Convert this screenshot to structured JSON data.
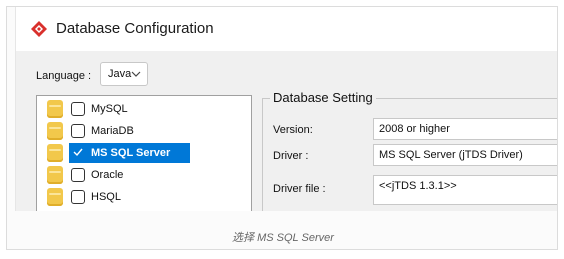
{
  "window": {
    "title": "Database Configuration",
    "icon": "app-logo-icon"
  },
  "language": {
    "label": "Language :",
    "value": "Java"
  },
  "databases": [
    {
      "label": "MySQL",
      "checked": false,
      "selected": false
    },
    {
      "label": "MariaDB",
      "checked": false,
      "selected": false
    },
    {
      "label": "MS SQL Server",
      "checked": true,
      "selected": true
    },
    {
      "label": "Oracle",
      "checked": false,
      "selected": false
    },
    {
      "label": "HSQL",
      "checked": false,
      "selected": false
    }
  ],
  "database_setting": {
    "title": "Database Setting",
    "version_label": "Version:",
    "version_value": "2008 or higher",
    "driver_label": "Driver :",
    "driver_value": "MS SQL Server (jTDS Driver)",
    "driver_file_label": "Driver file :",
    "driver_file_value": "<<jTDS 1.3.1>>"
  },
  "caption": "选择 MS SQL Server",
  "colors": {
    "selection": "#0078d7",
    "db_icon": "#f2c84b",
    "logo": "#d9302c"
  }
}
